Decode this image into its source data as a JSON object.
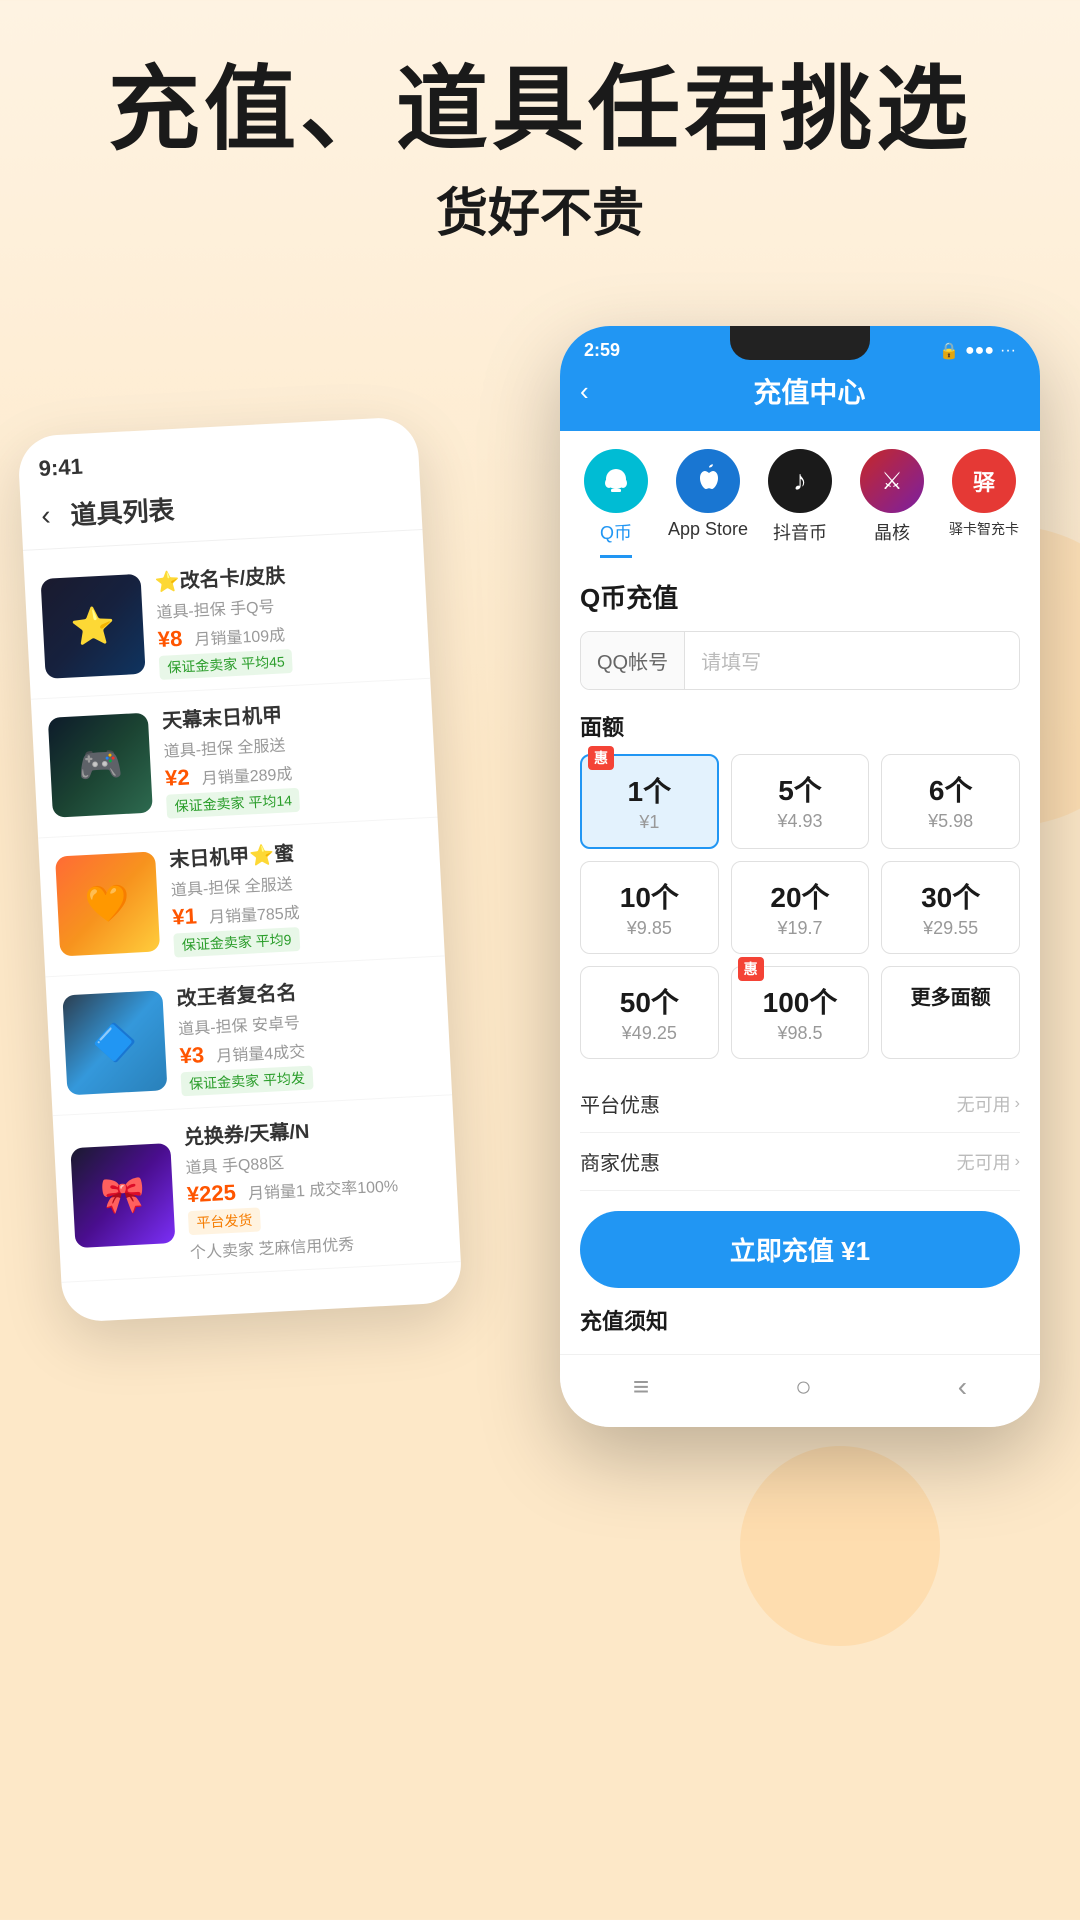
{
  "hero": {
    "title": "充值、道具任君挑选",
    "subtitle": "货好不贵"
  },
  "left_phone": {
    "status_time": "9:41",
    "toolbar_back": "‹",
    "toolbar_title": "道具列表",
    "items": [
      {
        "id": "item-1",
        "name": "⭐改名卡/皮肤",
        "desc": "道具-担保 手Q号",
        "price": "¥8",
        "sales": "月销量109成",
        "tag": "保证金卖家 平均45",
        "img_class": "img-1"
      },
      {
        "id": "item-2",
        "name": "天幕末日机甲",
        "desc": "道具-担保 全服送",
        "price": "¥2",
        "sales": "月销量289成",
        "tag": "保证金卖家 平均14",
        "img_class": "img-2"
      },
      {
        "id": "item-3",
        "name": "末日机甲⭐蜜",
        "desc": "道具-担保 全服送",
        "price": "¥1",
        "sales": "月销量785 成",
        "tag": "保证金卖家 平均9",
        "img_class": "img-3"
      },
      {
        "id": "item-4",
        "name": "改王者复名名",
        "desc": "道具-担保 安卓号",
        "price": "¥3",
        "sales": "月销量4 成交",
        "tag": "保证金卖家 平均发",
        "img_class": "img-4"
      },
      {
        "id": "item-5",
        "name": "兑换券/天幕/N",
        "desc": "道具 手Q88区",
        "price": "¥225",
        "sales": "月销量1 成交率100%",
        "tag": "平台发货",
        "tag2": "个人卖家 芝麻信用优秀",
        "img_class": "img-5"
      }
    ]
  },
  "right_phone": {
    "status_time": "2:59",
    "status_icons": "📶 WiFi 66",
    "header_back": "‹",
    "header_title": "充值中心",
    "tabs": [
      {
        "id": "tab-qb",
        "label": "Q币",
        "active": true,
        "color": "teal-bg",
        "icon": "Q"
      },
      {
        "id": "tab-appstore",
        "label": "App Store",
        "active": false,
        "color": "blue-bg",
        "icon": ""
      },
      {
        "id": "tab-douyin",
        "label": "抖音币",
        "active": false,
        "color": "black-bg",
        "icon": "♪"
      },
      {
        "id": "tab-jinghe",
        "label": "晶核",
        "active": false,
        "color": "pink-bg",
        "icon": "⚔"
      },
      {
        "id": "tab-junka",
        "label": "驿卡智充卡",
        "active": false,
        "color": "red-bg",
        "icon": "驿"
      }
    ],
    "section_title": "Q币充值",
    "input_label": "QQ帐号",
    "input_placeholder": "请填写",
    "denom_label": "面额",
    "denominations": [
      {
        "id": "d1",
        "num": "1个",
        "price": "¥1",
        "active": true,
        "badge": "惠"
      },
      {
        "id": "d5",
        "num": "5个",
        "price": "¥4.93",
        "active": false,
        "badge": ""
      },
      {
        "id": "d6",
        "num": "6个",
        "price": "¥5.98",
        "active": false,
        "badge": ""
      },
      {
        "id": "d10",
        "num": "10个",
        "price": "¥9.85",
        "active": false,
        "badge": ""
      },
      {
        "id": "d20",
        "num": "20个",
        "price": "¥19.7",
        "active": false,
        "badge": ""
      },
      {
        "id": "d30",
        "num": "30个",
        "price": "¥29.55",
        "active": false,
        "badge": ""
      },
      {
        "id": "d50",
        "num": "50个",
        "price": "¥49.25",
        "active": false,
        "badge": ""
      },
      {
        "id": "d100",
        "num": "100个",
        "price": "¥98.5",
        "active": false,
        "badge": "惠"
      },
      {
        "id": "dmore",
        "num": "更多面额",
        "price": "",
        "active": false,
        "badge": ""
      }
    ],
    "platform_discount_label": "平台优惠",
    "platform_discount_val": "无可用",
    "merchant_discount_label": "商家优惠",
    "merchant_discount_val": "无可用",
    "charge_btn": "立即充值 ¥1",
    "notice_title": "充值须知",
    "bottom_nav": [
      "≡",
      "○",
      "‹"
    ]
  }
}
